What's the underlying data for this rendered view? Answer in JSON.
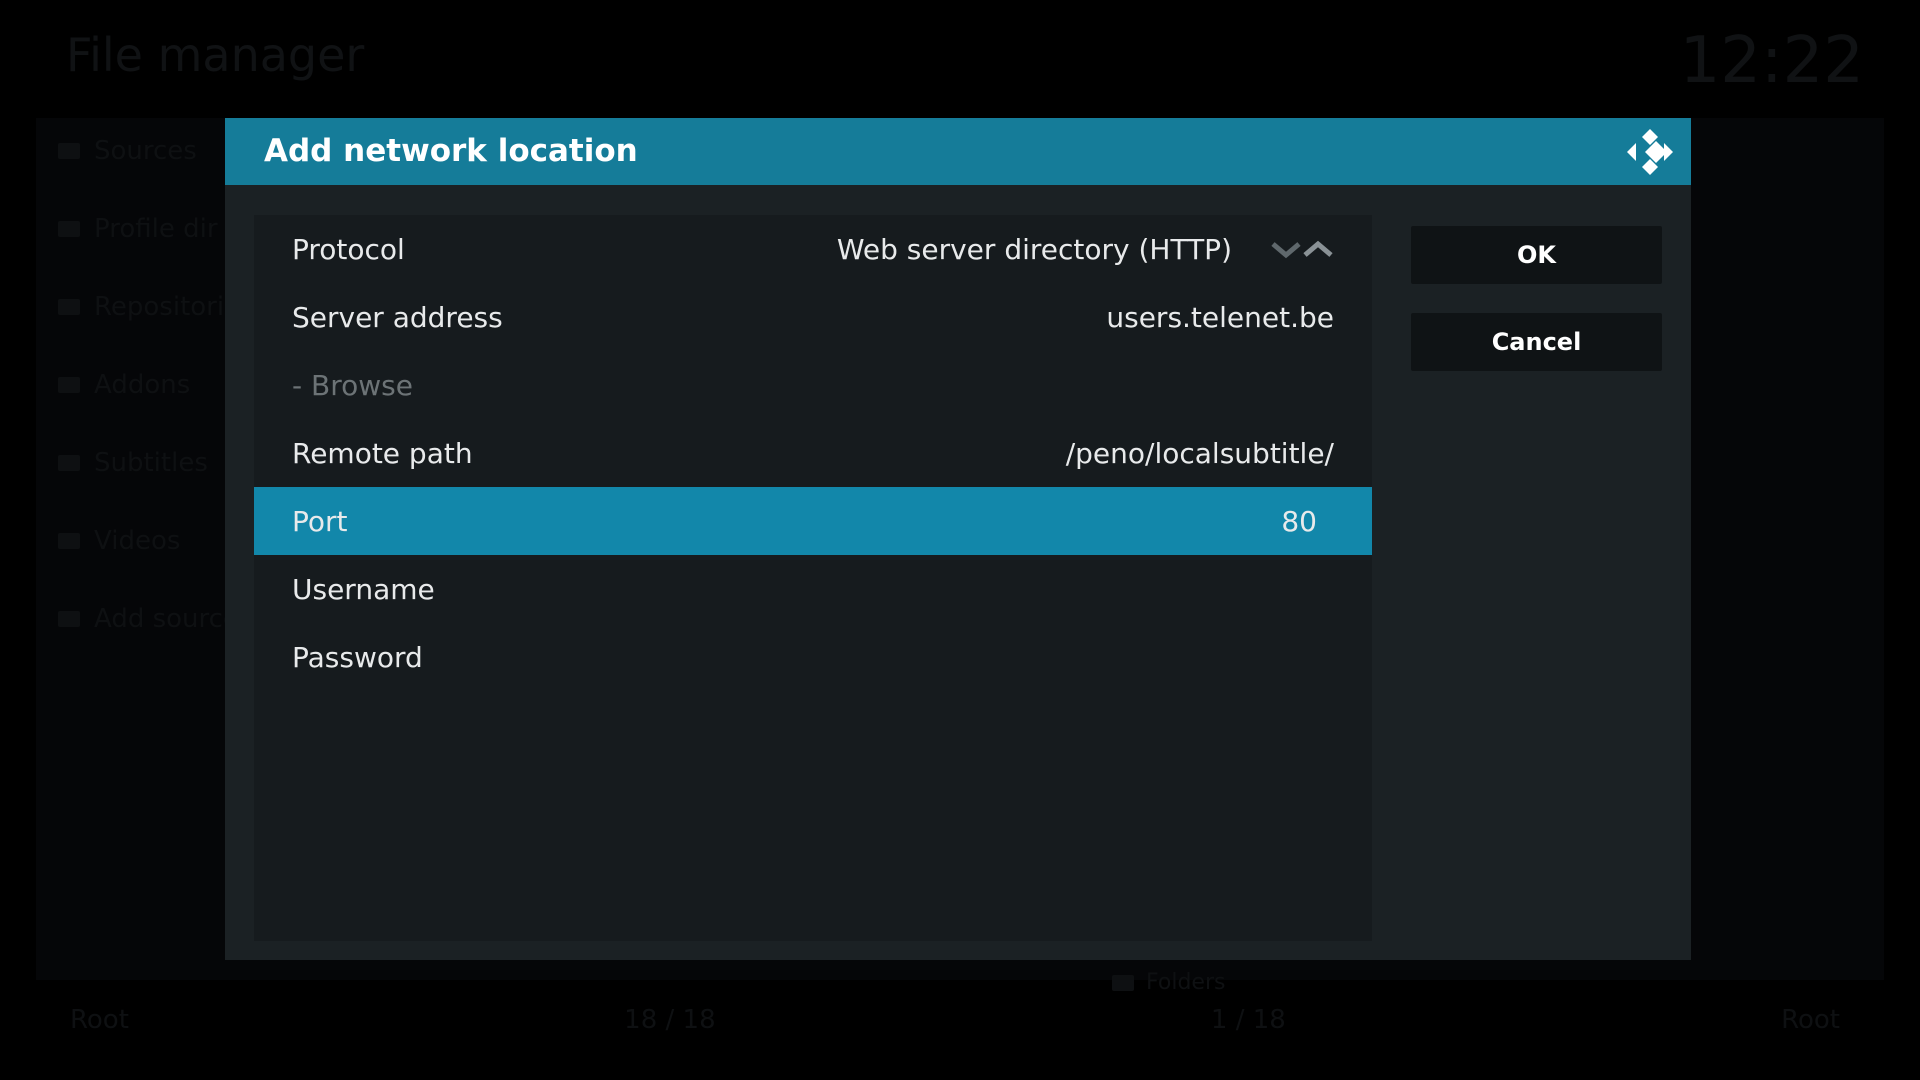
{
  "background": {
    "title": "File manager",
    "clock": "12:22",
    "sources": [
      "Sources",
      "Profile dir",
      "Repositories",
      "Addons",
      "Subtitles",
      "Videos",
      "Add source"
    ],
    "parent_folder": "Folders",
    "footer": {
      "left": "Root",
      "count_left": "18 / 18",
      "count_right": "1 / 18",
      "right": "Root"
    }
  },
  "dialog": {
    "title": "Add network location",
    "rows": [
      {
        "label": "Protocol",
        "value": "Web server directory (HTTP)"
      },
      {
        "label": "Server address",
        "value": "users.telenet.be"
      },
      {
        "label": "- Browse",
        "value": ""
      },
      {
        "label": "Remote path",
        "value": "/peno/localsubtitle/"
      },
      {
        "label": "Port",
        "value": "80"
      },
      {
        "label": "Username",
        "value": ""
      },
      {
        "label": "Password",
        "value": ""
      }
    ],
    "buttons": {
      "ok": "OK",
      "cancel": "Cancel"
    }
  },
  "colors": {
    "header": "#157c99",
    "focused_row": "#1287aa",
    "dialog_bg": "#1b2124",
    "panel_bg": "#161b1e"
  }
}
